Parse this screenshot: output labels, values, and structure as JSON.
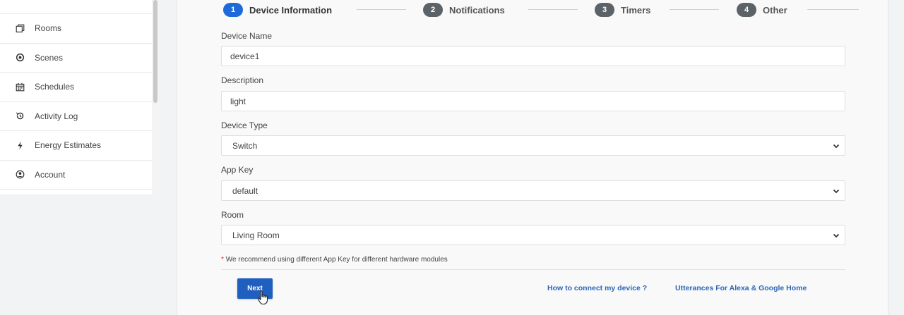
{
  "sidebar": {
    "items": [
      {
        "label": "",
        "icon": "blank"
      },
      {
        "label": "Rooms",
        "icon": "rooms-icon"
      },
      {
        "label": "Scenes",
        "icon": "scenes-icon"
      },
      {
        "label": "Schedules",
        "icon": "calendar-icon"
      },
      {
        "label": "Activity Log",
        "icon": "history-icon"
      },
      {
        "label": "Energy Estimates",
        "icon": "bolt-icon"
      },
      {
        "label": "Account",
        "icon": "user-circle-icon"
      }
    ]
  },
  "stepper": {
    "steps": [
      {
        "num": "1",
        "label": "Device Information",
        "active": true
      },
      {
        "num": "2",
        "label": "Notifications",
        "active": false
      },
      {
        "num": "3",
        "label": "Timers",
        "active": false
      },
      {
        "num": "4",
        "label": "Other",
        "active": false
      }
    ]
  },
  "form": {
    "device_name": {
      "label": "Device Name",
      "value": "device1"
    },
    "description": {
      "label": "Description",
      "value": "light"
    },
    "device_type": {
      "label": "Device Type",
      "value": "Switch"
    },
    "app_key": {
      "label": "App Key",
      "value": "default"
    },
    "room": {
      "label": "Room",
      "value": "Living Room"
    },
    "note_star": "*",
    "note": "We recommend using different App Key for different hardware modules"
  },
  "actions": {
    "next_label": "Next",
    "link_connect": "How to connect my device ?",
    "link_utterances": "Utterances For Alexa & Google Home"
  },
  "colors": {
    "primary": "#1f5fbf",
    "active_step": "#1e6ad8",
    "inactive_step": "#5c6368",
    "link": "#2b66b8"
  }
}
